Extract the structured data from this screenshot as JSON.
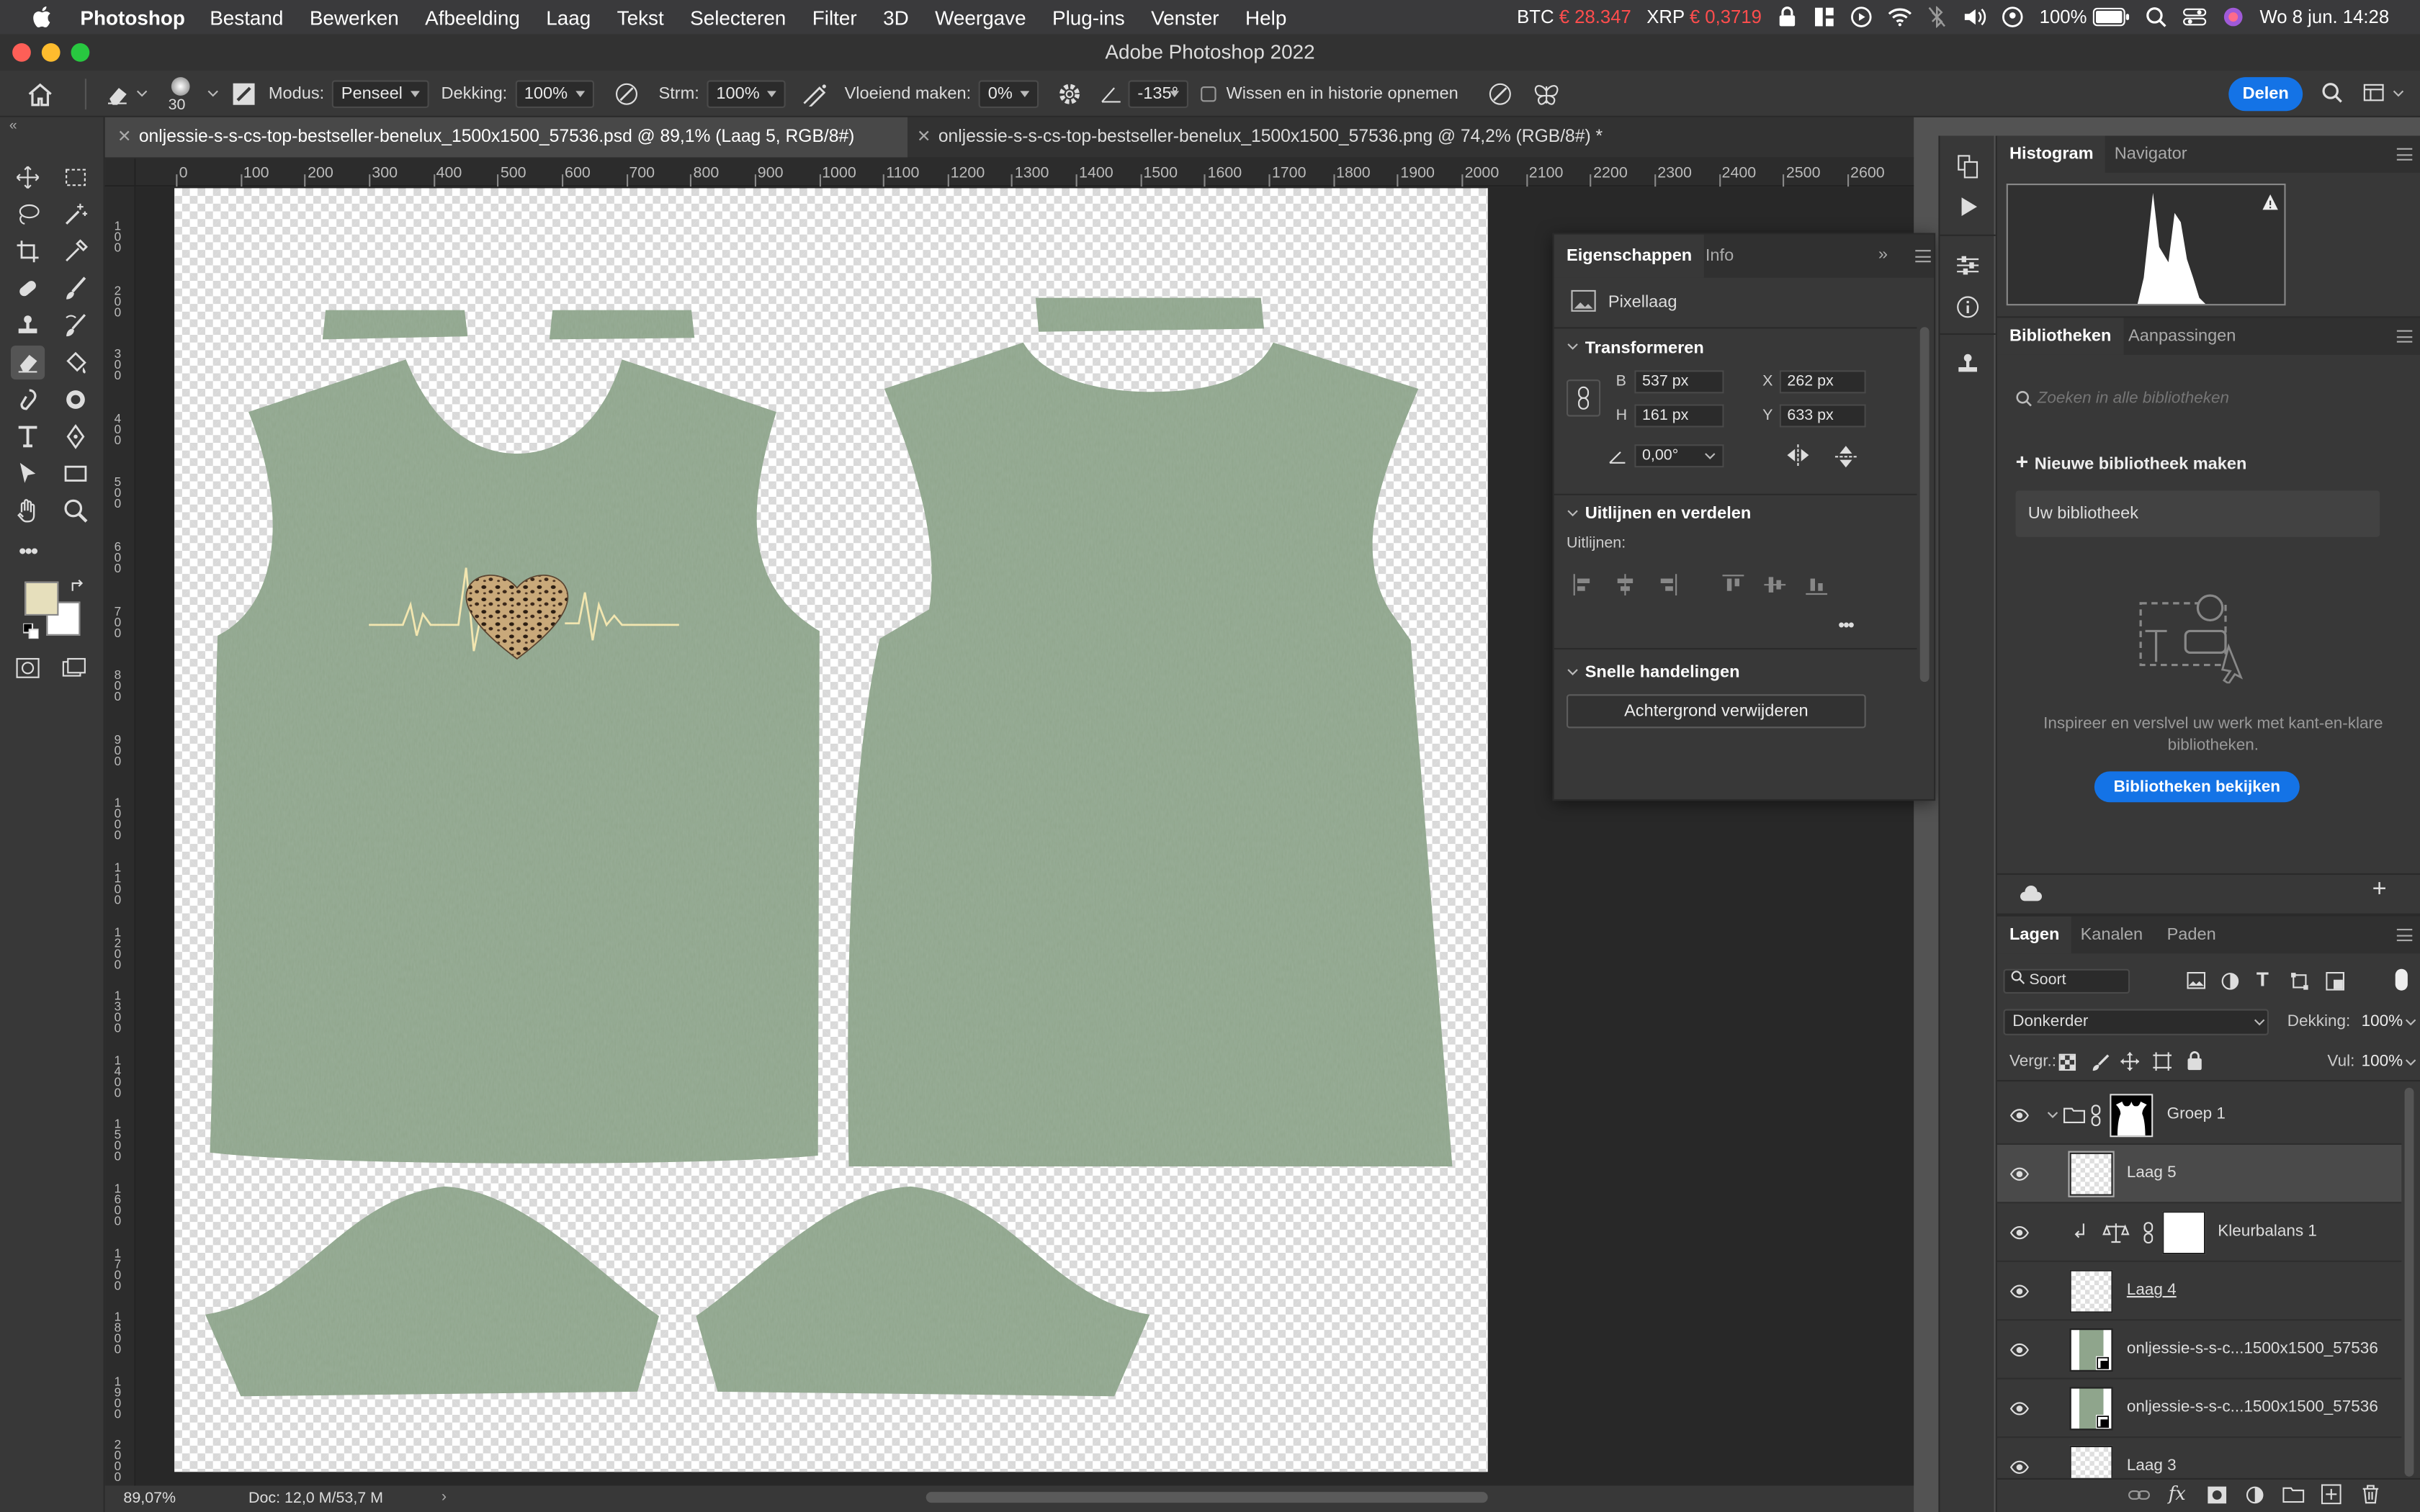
{
  "menubar": {
    "app_name": "Photoshop",
    "items": [
      "Bestand",
      "Bewerken",
      "Afbeelding",
      "Laag",
      "Tekst",
      "Selecteren",
      "Filter",
      "3D",
      "Weergave",
      "Plug-ins",
      "Venster",
      "Help"
    ],
    "ticker_btc_label": "BTC",
    "ticker_btc_value": "€ 28.347",
    "ticker_xrp_label": "XRP",
    "ticker_xrp_value": "€ 0,3719",
    "battery": "100%",
    "datetime": "Wo 8 jun.  14:28"
  },
  "window": {
    "title": "Adobe Photoshop 2022"
  },
  "options_bar": {
    "brush_size": "30",
    "mode_label": "Modus:",
    "mode_value": "Penseel",
    "opacity_label": "Dekking:",
    "opacity_value": "100%",
    "flow_label": "Strm:",
    "flow_value": "100%",
    "smoothing_label": "Vloeiend maken:",
    "smoothing_value": "0%",
    "angle_value": "-135°",
    "erase_history_label": "Wissen en in historie opnemen",
    "share_label": "Delen"
  },
  "doc_tabs": [
    {
      "title": "onljessie-s-s-cs-top-bestseller-benelux_1500x1500_57536.psd @ 89,1% (Laag 5, RGB/8#)",
      "active": true
    },
    {
      "title": "onljessie-s-s-cs-top-bestseller-benelux_1500x1500_57536.png @ 74,2% (RGB/8#) *",
      "active": false
    }
  ],
  "ruler_h": [
    "0",
    "100",
    "200",
    "300",
    "400",
    "500",
    "600",
    "700",
    "800",
    "900",
    "1000",
    "1100",
    "1200",
    "1300",
    "1400",
    "1500",
    "1600",
    "1700",
    "1800",
    "1900",
    "2000",
    "2100",
    "2200",
    "2300",
    "2400",
    "2500",
    "2600"
  ],
  "ruler_v": [
    "1 0 0",
    "2 0 0",
    "3 0 0",
    "4 0 0",
    "5 0 0",
    "6 0 0",
    "7 0 0",
    "8 0 0",
    "9 0 0",
    "1 0 0 0",
    "1 1 0 0",
    "1 2 0 0",
    "1 3 0 0",
    "1 4 0 0",
    "1 5 0 0",
    "1 6 0 0",
    "1 7 0 0",
    "1 8 0 0",
    "1 9 0 0",
    "2 0 0 0"
  ],
  "status": {
    "zoom": "89,07%",
    "doc_size": "Doc: 12,0 M/53,7 M"
  },
  "properties": {
    "tabs": [
      "Eigenschappen",
      "Info"
    ],
    "layer_type": "Pixellaag",
    "transform_title": "Transformeren",
    "w_label": "B",
    "w_value": "537 px",
    "h_label": "H",
    "h_value": "161 px",
    "x_label": "X",
    "x_value": "262 px",
    "y_label": "Y",
    "y_value": "633 px",
    "angle_value": "0,00°",
    "align_title": "Uitlijnen en verdelen",
    "align_label": "Uitlijnen:",
    "quick_title": "Snelle handelingen",
    "remove_bg_label": "Achtergrond verwijderen"
  },
  "histogram": {
    "tabs": [
      "Histogram",
      "Navigator"
    ]
  },
  "libraries": {
    "tabs": [
      "Bibliotheken",
      "Aanpassingen"
    ],
    "search_placeholder": "Zoeken in alle bibliotheken",
    "new_library": "Nieuwe bibliotheek maken",
    "your_library": "Uw bibliotheek",
    "promo_text": "Inspireer en verslvel uw werk met kant-en-klare bibliotheken.",
    "view_button": "Bibliotheken bekijken"
  },
  "layers": {
    "tabs": [
      "Lagen",
      "Kanalen",
      "Paden"
    ],
    "filter_value": "Soort",
    "blend_mode": "Donkerder",
    "opacity_label": "Dekking:",
    "opacity_value": "100%",
    "lock_label": "Vergr.:",
    "fill_label": "Vul:",
    "fill_value": "100%",
    "items": [
      {
        "name": "Groep 1",
        "kind": "group"
      },
      {
        "name": "Laag 5",
        "kind": "pixel",
        "selected": true
      },
      {
        "name": "Kleurbalans 1",
        "kind": "adjustment"
      },
      {
        "name": "Laag 4",
        "kind": "pixel"
      },
      {
        "name": "onljessie-s-s-c...1500x1500_57536",
        "kind": "smart"
      },
      {
        "name": "onljessie-s-s-c...1500x1500_57536",
        "kind": "smart"
      },
      {
        "name": "Laag 3",
        "kind": "pixel"
      }
    ]
  },
  "colors": {
    "fabric": "#8fa58c",
    "heartbeat": "#f2e6b0",
    "accent_blue": "#1473e6",
    "foreground_swatch": "#e6dfbc",
    "background_swatch": "#ffffff"
  }
}
